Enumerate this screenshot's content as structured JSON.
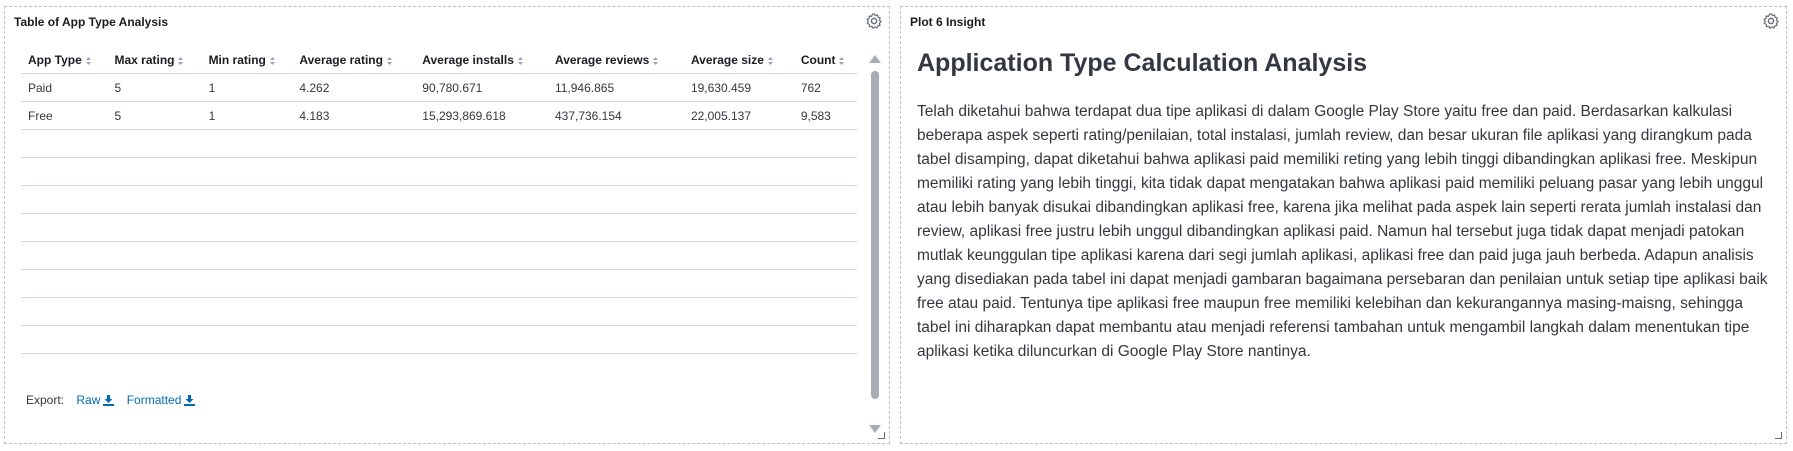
{
  "left_panel": {
    "title": "Table of App Type Analysis",
    "columns": [
      "App Type",
      "Max rating",
      "Min rating",
      "Average rating",
      "Average installs",
      "Average reviews",
      "Average size",
      "Count"
    ],
    "rows": [
      [
        "Paid",
        "5",
        "1",
        "4.262",
        "90,780.671",
        "11,946.865",
        "19,630.459",
        "762"
      ],
      [
        "Free",
        "5",
        "1",
        "4.183",
        "15,293,869.618",
        "437,736.154",
        "22,005.137",
        "9,583"
      ]
    ],
    "export": {
      "label": "Export:",
      "raw": "Raw",
      "formatted": "Formatted"
    }
  },
  "right_panel": {
    "title": "Plot 6 Insight",
    "heading": "Application Type Calculation Analysis",
    "body": "Telah diketahui bahwa terdapat dua tipe aplikasi di dalam Google Play Store yaitu free dan paid. Berdasarkan kalkulasi beberapa aspek seperti rating/penilaian, total instalasi, jumlah review, dan besar ukuran file aplikasi yang dirangkum pada tabel disamping, dapat diketahui bahwa aplikasi paid memiliki reting yang lebih tinggi dibandingkan aplikasi free. Meskipun memiliki rating yang lebih tinggi, kita tidak dapat mengatakan bahwa aplikasi paid memiliki peluang pasar yang lebih unggul atau lebih banyak disukai dibandingkan aplikasi free, karena jika melihat pada aspek lain seperti rerata jumlah instalasi dan review, aplikasi free justru lebih unggul dibandingkan aplikasi paid. Namun hal tersebut juga tidak dapat menjadi patokan mutlak keunggulan tipe aplikasi karena dari segi jumlah aplikasi, aplikasi free dan paid juga jauh berbeda. Adapun analisis yang disediakan pada tabel ini dapat menjadi gambaran bagaimana persebaran dan penilaian untuk setiap tipe aplikasi baik free atau paid. Tentunya tipe aplikasi free maupun free memiliki kelebihan dan kekurangannya masing-maisng, sehingga tabel ini diharapkan dapat membantu atau menjadi referensi tambahan untuk mengambil langkah dalam menentukan tipe aplikasi ketika diluncurkan di Google Play Store nantinya."
  },
  "colors": {
    "link": "#006bb4",
    "border": "#d3dae6",
    "text": "#343741"
  },
  "icons": [
    "gear-icon",
    "sort-icon",
    "download-icon",
    "resize-handle-icon"
  ]
}
